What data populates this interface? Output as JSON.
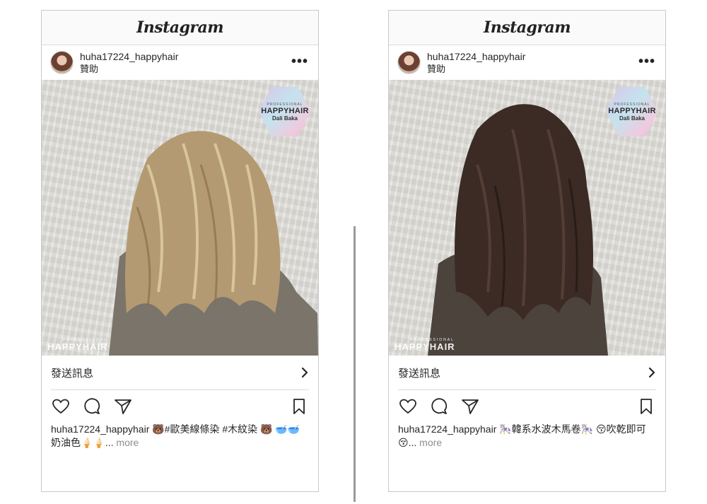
{
  "posts": [
    {
      "app_title": "Instagram",
      "username": "huha17224_happyhair",
      "sponsored": "贊助",
      "more": "•••",
      "badge": {
        "small": "PROFESSIONAL",
        "brand": "HAPPYHAIR",
        "location": "Dali Baka"
      },
      "watermark": {
        "small": "PROFESSIONAL",
        "brand": "HAPPYHAIR"
      },
      "send_message": "發送訊息",
      "send_chevron": "›",
      "caption_user": "huha17224_happyhair",
      "caption_text": " 🐻#歐美線條染 #木紋染 🐻 🥣🥣奶油色🍦🍦... ",
      "caption_more": "more",
      "hair_color": "#b49a72",
      "icons": [
        "heart-icon",
        "comment-icon",
        "share-icon",
        "bookmark-icon"
      ]
    },
    {
      "app_title": "Instagram",
      "username": "huha17224_happyhair",
      "sponsored": "贊助",
      "more": "•••",
      "badge": {
        "small": "PROFESSIONAL",
        "brand": "HAPPYHAIR",
        "location": "Dali Baka"
      },
      "watermark": {
        "small": "PROFESSIONAL",
        "brand": "HAPPYHAIR"
      },
      "send_message": "發送訊息",
      "send_chevron": "›",
      "caption_user": "huha17224_happyhair",
      "caption_text": " 🎠韓系水波木馬卷🎠 😚吹乾即可😚... ",
      "caption_more": "more",
      "hair_color": "#3b2b24",
      "icons": [
        "heart-icon",
        "comment-icon",
        "share-icon",
        "bookmark-icon"
      ]
    }
  ]
}
